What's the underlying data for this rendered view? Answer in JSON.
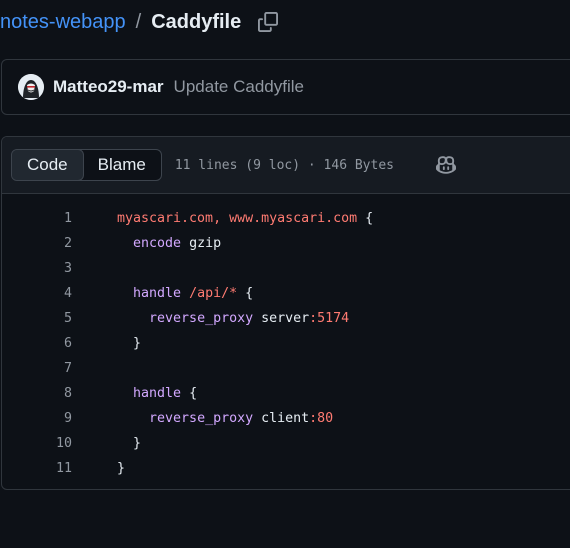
{
  "breadcrumb": {
    "repo": "notes-webapp",
    "separator": "/",
    "file": "Caddyfile"
  },
  "commit": {
    "author": "Matteo29-mar",
    "message": "Update Caddyfile"
  },
  "file_header": {
    "tabs": [
      {
        "label": "Code",
        "active": true
      },
      {
        "label": "Blame",
        "active": false
      }
    ],
    "meta": "11 lines (9 loc) · 146 Bytes"
  },
  "code": {
    "line_numbers": [
      "1",
      "2",
      "3",
      "4",
      "5",
      "6",
      "7",
      "8",
      "9",
      "10",
      "11"
    ],
    "lines": [
      {
        "indent": "",
        "tokens": [
          {
            "t": "myascari.com, www.myascari.com",
            "c": "str"
          },
          {
            "t": " {",
            "c": "plain"
          }
        ]
      },
      {
        "indent": "  ",
        "tokens": [
          {
            "t": "encode",
            "c": "kw"
          },
          {
            "t": " gzip",
            "c": "plain"
          }
        ]
      },
      {
        "indent": "",
        "tokens": []
      },
      {
        "indent": "  ",
        "tokens": [
          {
            "t": "handle",
            "c": "kw"
          },
          {
            "t": " ",
            "c": "plain"
          },
          {
            "t": "/api/*",
            "c": "str"
          },
          {
            "t": " {",
            "c": "plain"
          }
        ]
      },
      {
        "indent": "    ",
        "tokens": [
          {
            "t": "reverse_proxy",
            "c": "kw"
          },
          {
            "t": " server",
            "c": "plain"
          },
          {
            "t": ":5174",
            "c": "num"
          }
        ]
      },
      {
        "indent": "  ",
        "tokens": [
          {
            "t": "}",
            "c": "plain"
          }
        ]
      },
      {
        "indent": "",
        "tokens": []
      },
      {
        "indent": "  ",
        "tokens": [
          {
            "t": "handle",
            "c": "kw"
          },
          {
            "t": " {",
            "c": "plain"
          }
        ]
      },
      {
        "indent": "    ",
        "tokens": [
          {
            "t": "reverse_proxy",
            "c": "kw"
          },
          {
            "t": " client",
            "c": "plain"
          },
          {
            "t": ":80",
            "c": "num"
          }
        ]
      },
      {
        "indent": "  ",
        "tokens": [
          {
            "t": "}",
            "c": "plain"
          }
        ]
      },
      {
        "indent": "",
        "tokens": [
          {
            "t": "}",
            "c": "plain"
          }
        ]
      }
    ]
  },
  "colors": {
    "background": "#0d1117",
    "link": "#4493f8",
    "string": "#ff7b72",
    "keyword": "#d2a8ff"
  },
  "icons": [
    "copy-path-icon",
    "avatar-icon",
    "copilot-icon"
  ]
}
